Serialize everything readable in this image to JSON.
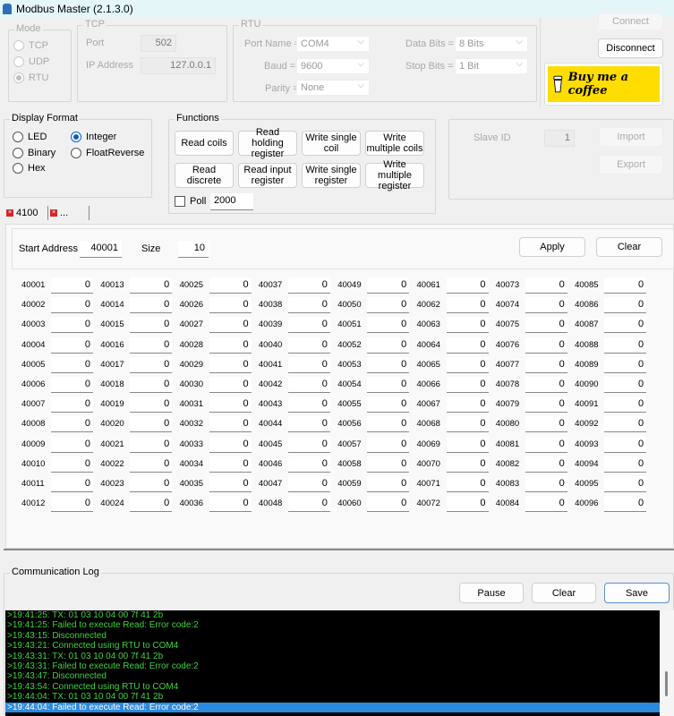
{
  "window": {
    "title": "Modbus Master (2.1.3.0)"
  },
  "mode": {
    "label": "Mode",
    "options": [
      "TCP",
      "UDP",
      "RTU"
    ],
    "selected": "RTU"
  },
  "tcp": {
    "label": "TCP",
    "port_label": "Port",
    "port": "502",
    "ip_label": "IP Address",
    "ip": "127.0.0.1"
  },
  "rtu": {
    "label": "RTU",
    "port_name_label": "Port Name =",
    "port_name": "COM4",
    "baud_label": "Baud =",
    "baud": "9600",
    "parity_label": "Parity =",
    "parity": "None",
    "data_bits_label": "Data Bits =",
    "data_bits": "8 Bits",
    "stop_bits_label": "Stop Bits =",
    "stop_bits": "1 Bit"
  },
  "connection": {
    "connect": "Connect",
    "disconnect": "Disconnect",
    "coffee": "Buy me a coffee"
  },
  "display_format": {
    "label": "Display Format",
    "options": [
      "LED",
      "Binary",
      "Hex",
      "Integer",
      "FloatReverse"
    ],
    "selected": "Integer"
  },
  "functions": {
    "label": "Functions",
    "buttons": [
      "Read coils",
      "Read holding register",
      "Write single coil",
      "Write multiple coils",
      "Read discrete",
      "Read input register",
      "Write single register",
      "Write multiple register"
    ],
    "poll_label": "Poll",
    "poll_checked": false,
    "poll_interval": "2000"
  },
  "slave": {
    "label": "Slave ID",
    "value": "1",
    "import": "Import",
    "export": "Export"
  },
  "tabs": [
    {
      "label": "4100"
    },
    {
      "label": "..."
    }
  ],
  "register_panel": {
    "start_label": "Start Address",
    "start": "40001",
    "size_label": "Size",
    "size": "10",
    "apply": "Apply",
    "clear": "Clear"
  },
  "registers": [],
  "register_start": 40001,
  "register_count": 96,
  "register_value": "0",
  "log": {
    "label": "Communication Log",
    "pause": "Pause",
    "clear": "Clear",
    "save": "Save",
    "lines": [
      ">19:41:25: TX: 01 03 10 04 00 7f 41 2b",
      ">19:41:25: Failed to execute Read: Error code:2",
      ">19:43:15: Disconnected",
      ">19:43:21: Connected using RTU to COM4",
      ">19:43:31: TX: 01 03 10 04 00 7f 41 2b",
      ">19:43:31: Failed to execute Read: Error code:2",
      ">19:43:47: Disconnected",
      ">19:43:54: Connected using RTU to COM4",
      ">19:44:04: TX: 01 03 10 04 00 7f 41 2b",
      ">19:44:04: Failed to execute Read: Error code:2"
    ],
    "selected_index": 9
  },
  "colors": {
    "log_text": "#3fd23f",
    "log_bg": "#000000",
    "selection": "#2a8ae0",
    "coffee": "#ffdd00"
  }
}
